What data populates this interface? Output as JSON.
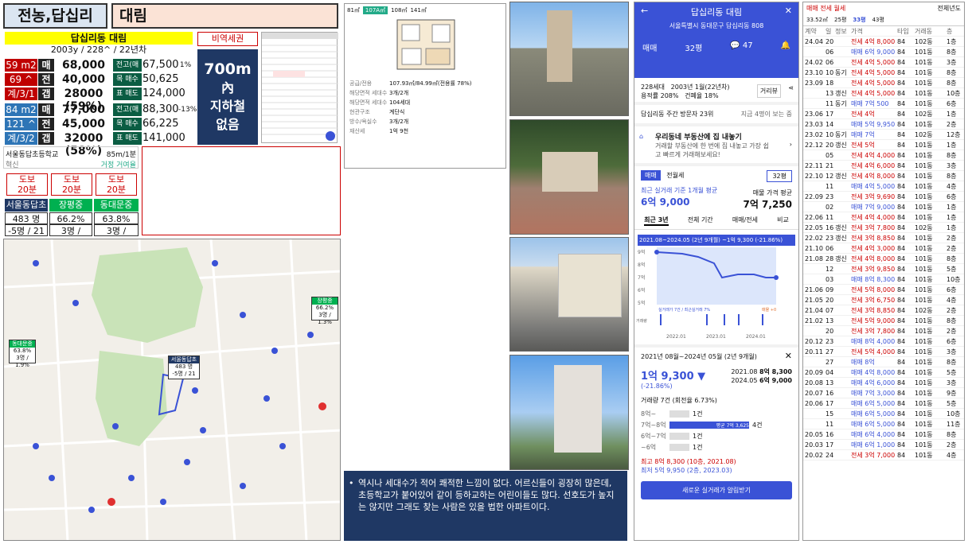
{
  "header": {
    "region": "전농,답십리",
    "name": "대림"
  },
  "summary": {
    "title": "답십리동 대림",
    "info": "2003y / 228^ / 22년차",
    "rows": [
      {
        "c1": "59 m2",
        "c2": "매",
        "c3": "68,000",
        "c4": "전고(매매)",
        "c5": "67,500",
        "c6": "1%"
      },
      {
        "c1": "69 ^",
        "c2": "전",
        "c3": "40,000",
        "c4": "목 매수",
        "c5": "50,625",
        "c6": ""
      },
      {
        "c1": "계/3/1",
        "c2": "갭",
        "c3": "28000 (59%)",
        "c4": "표 매도",
        "c5": "124,000",
        "c6": ""
      },
      {
        "c1": "84 m2",
        "c2": "매",
        "c3": "77,000",
        "c4": "전고(매매)",
        "c5": "88,300",
        "c6": "-13%"
      },
      {
        "c1": "121 ^",
        "c2": "전",
        "c3": "45,000",
        "c4": "목 매수",
        "c5": "66,225",
        "c6": ""
      },
      {
        "c1": "계/3/2",
        "c2": "갭",
        "c3": "32000 (58%)",
        "c4": "표 매도",
        "c5": "141,000",
        "c6": ""
      }
    ]
  },
  "transit": {
    "title": "비역세권",
    "distance": "700m",
    "line2": "內",
    "line3": "지하철",
    "line4": "없음"
  },
  "school_card": {
    "name": "서울동답초등학교",
    "dist": "85m/1분",
    "sub": "혁신",
    "sub2": "거정 거여율"
  },
  "walks": [
    {
      "l1": "도보",
      "l2": "20분"
    },
    {
      "l1": "도보",
      "l2": "20분"
    },
    {
      "l1": "도보",
      "l2": "20분"
    }
  ],
  "schools": [
    {
      "name": "서울동답초",
      "v1": "483 명",
      "v2": "-5명 / 21"
    },
    {
      "name": "장평중",
      "v1": "66.2%",
      "v2": "3명 / 1.3%"
    },
    {
      "name": "동대문중",
      "v1": "63.8%",
      "v2": "3명 / 1.9%"
    }
  ],
  "map": {
    "label1_name": "장평중",
    "label1_v1": "66.2%",
    "label1_v2": "3명 / 1.3%",
    "label2_name": "동대문중",
    "label2_v1": "63.8%",
    "label2_v2": "3명 / 1.9%",
    "label3_name": "서울동답초",
    "label3_v1": "483 명",
    "label3_v2": "-5명 / 21"
  },
  "floorplan": {
    "tab1": "81㎡",
    "tab2": "107A㎡",
    "tab3": "108㎡",
    "tab4": "141㎡",
    "details": [
      [
        "공급/전용",
        "107.93㎡/84.99㎡(전용률 78%)"
      ],
      [
        "해당면적 세대수",
        "3개/2개"
      ],
      [
        "해당면적 세대수",
        "104세대"
      ],
      [
        "현관구조",
        "계단식"
      ],
      [
        "방수/욕실수",
        "3개/2개"
      ],
      [
        "재산세",
        "1억 9천"
      ]
    ]
  },
  "note": "역시나 세대수가 적어 쾌적한 느낌이 없다. 어르신들이 굉장히 많은데, 초등학교가 붙어있어 같이 등하교하는 어린이들도 많다. 선호도가 높지는 않지만 그래도 찾는 사람은 있을 법한 아파트이다.",
  "app": {
    "title": "답십리동 대림",
    "address": "서울특별시 동대문구 답십리동 808",
    "tab_sale": "매매",
    "tab_size": "32평",
    "chat": "47",
    "info1": "228세대",
    "info2": "2003년 1월(22년차)",
    "info3": "용적률 208%",
    "info4": "건폐율 18%",
    "btn": "거리뷰",
    "visitors": "답십리동 주간 방문자 23위",
    "visitors_link": "지금 4명이 보는 중",
    "promo_title": "우리동네 부동산에 집 내놓기",
    "promo_sub": "거래할 부동산에 한 번에 집 내놓고 가장 쉽고 빠르게 거래해보세요!",
    "toggle1": "매매",
    "toggle2": "전월세",
    "size": "32평",
    "recent_label": "최근 실거래 기준 1개월 평균",
    "recent_price": "6억 9,000",
    "ask_label": "매물 가격 평균",
    "ask_price": "7억 7,250",
    "tabs": [
      "최근 3년",
      "전체 기간",
      "매매/전세",
      "비교"
    ],
    "range": "2021.08~2024.05 (2년 9개월) ~1억 9,300 (-21.86%)",
    "ylabels": [
      "9억",
      "8억",
      "7억",
      "6억",
      "5억"
    ],
    "xlabels": [
      "2022.01",
      "2023.01",
      "2024.01"
    ],
    "avg_label": "실거래가 7건 / 최근실거래 7%",
    "jeonse_label": "매물 +0",
    "volume": "거래량",
    "popup_range": "2021년 08월~2024년 05월 (2년 9개월)",
    "drop": "1억 9,300 ▼",
    "drop_pct": "(-21.86%)",
    "hi_date": "2021.08",
    "hi_val": "8억 8,300",
    "lo_date": "2024.05",
    "lo_val": "6억 9,000",
    "count": "거래량 7건 (회전율 6.73%)",
    "hist": [
      {
        "label": "8억~",
        "count": "1건"
      },
      {
        "label": "7억~8억",
        "count": "4건",
        "avg": "평균 7억 3,625"
      },
      {
        "label": "6억~7억",
        "count": "1건"
      },
      {
        "label": "~6억",
        "count": "1건"
      }
    ],
    "max": "최고 8억 8,300 (10층, 2021.08)",
    "min": "최저 5억 9,950 (2층, 2023.03)",
    "alert_btn": "새로운 실거래가 알림받기"
  },
  "tx": {
    "tabs": "매매 전세 월세",
    "filter": "전체년도",
    "sizes": [
      "33.52㎡",
      "25평",
      "33평",
      "43평"
    ],
    "header": [
      "계약",
      "일",
      "정보",
      "가격",
      "타입",
      "거래동",
      "층"
    ],
    "rows": [
      [
        "24.04",
        "20",
        "",
        "전세 4억 8,000",
        "84",
        "102동",
        "1층"
      ],
      [
        "",
        "06",
        "",
        "매매 6억 9,000",
        "84",
        "101동",
        "8층"
      ],
      [
        "24.02",
        "06",
        "",
        "전세 4억 5,000",
        "84",
        "101동",
        "3층"
      ],
      [
        "23.10",
        "10",
        "동기",
        "전세 4억 5,000",
        "84",
        "101동",
        "8층"
      ],
      [
        "23.09",
        "18",
        "",
        "전세 4억 5,000",
        "84",
        "101동",
        "8층"
      ],
      [
        "",
        "13",
        "갱신",
        "전세 4억 5,000",
        "84",
        "101동",
        "10층"
      ],
      [
        "",
        "11",
        "동기",
        "매매 7억 500",
        "84",
        "101동",
        "6층"
      ],
      [
        "23.06",
        "17",
        "",
        "전세 4억",
        "84",
        "102동",
        "1층"
      ],
      [
        "23.03",
        "14",
        "",
        "매매 5억 9,950",
        "84",
        "101동",
        "2층"
      ],
      [
        "23.02",
        "10",
        "동기",
        "매매 7억",
        "84",
        "102동",
        "12층"
      ],
      [
        "22.12",
        "20",
        "갱신",
        "전세 5억",
        "84",
        "101동",
        "1층"
      ],
      [
        "",
        "05",
        "",
        "전세 4억 4,000",
        "84",
        "101동",
        "8층"
      ],
      [
        "22.11",
        "21",
        "",
        "전세 4억 6,000",
        "84",
        "101동",
        "3층"
      ],
      [
        "22.10",
        "12",
        "갱신",
        "전세 4억 8,000",
        "84",
        "101동",
        "8층"
      ],
      [
        "",
        "11",
        "",
        "매매 4억 5,000",
        "84",
        "101동",
        "4층"
      ],
      [
        "22.09",
        "23",
        "",
        "전세 3억 9,690",
        "84",
        "101동",
        "6층"
      ],
      [
        "",
        "02",
        "",
        "매매 7억 9,000",
        "84",
        "101동",
        "1층"
      ],
      [
        "22.06",
        "11",
        "",
        "전세 4억 4,000",
        "84",
        "101동",
        "1층"
      ],
      [
        "22.05",
        "16",
        "갱신",
        "전세 3억 7,800",
        "84",
        "102동",
        "1층"
      ],
      [
        "22.02",
        "23",
        "갱신",
        "전세 3억 8,850",
        "84",
        "101동",
        "2층"
      ],
      [
        "21.10",
        "06",
        "",
        "전세 4억 3,000",
        "84",
        "101동",
        "2층"
      ],
      [
        "21.08",
        "28",
        "갱신",
        "전세 4억 8,000",
        "84",
        "101동",
        "8층"
      ],
      [
        "",
        "12",
        "",
        "전세 3억 9,850",
        "84",
        "101동",
        "5층"
      ],
      [
        "",
        "03",
        "",
        "매매 8억 8,300",
        "84",
        "101동",
        "10층"
      ],
      [
        "21.06",
        "09",
        "",
        "전세 5억 8,000",
        "84",
        "101동",
        "6층"
      ],
      [
        "21.05",
        "20",
        "",
        "전세 3억 6,750",
        "84",
        "101동",
        "4층"
      ],
      [
        "21.04",
        "07",
        "",
        "전세 3억 8,850",
        "84",
        "102동",
        "2층"
      ],
      [
        "21.02",
        "13",
        "",
        "전세 5억 9,000",
        "84",
        "101동",
        "8층"
      ],
      [
        "",
        "20",
        "",
        "전세 3억 7,800",
        "84",
        "101동",
        "2층"
      ],
      [
        "20.12",
        "23",
        "",
        "매매 8억 4,000",
        "84",
        "101동",
        "6층"
      ],
      [
        "20.11",
        "27",
        "",
        "전세 5억 4,000",
        "84",
        "101동",
        "3층"
      ],
      [
        "",
        "27",
        "",
        "매매 8억",
        "84",
        "101동",
        "8층"
      ],
      [
        "20.09",
        "04",
        "",
        "매매 4억 8,000",
        "84",
        "101동",
        "5층"
      ],
      [
        "20.08",
        "13",
        "",
        "매매 4억 6,000",
        "84",
        "101동",
        "3층"
      ],
      [
        "20.07",
        "16",
        "",
        "매매 7억 3,000",
        "84",
        "101동",
        "9층"
      ],
      [
        "20.06",
        "17",
        "",
        "매매 6억 5,000",
        "84",
        "101동",
        "5층"
      ],
      [
        "",
        "15",
        "",
        "매매 6억 5,000",
        "84",
        "101동",
        "10층"
      ],
      [
        "",
        "11",
        "",
        "매매 6억 5,000",
        "84",
        "101동",
        "11층"
      ],
      [
        "20.05",
        "16",
        "",
        "매매 6억 4,000",
        "84",
        "101동",
        "8층"
      ],
      [
        "20.03",
        "17",
        "",
        "매매 6억 1,000",
        "84",
        "101동",
        "2층"
      ],
      [
        "20.02",
        "24",
        "",
        "전세 3억 7,000",
        "84",
        "101동",
        "4층"
      ]
    ]
  }
}
